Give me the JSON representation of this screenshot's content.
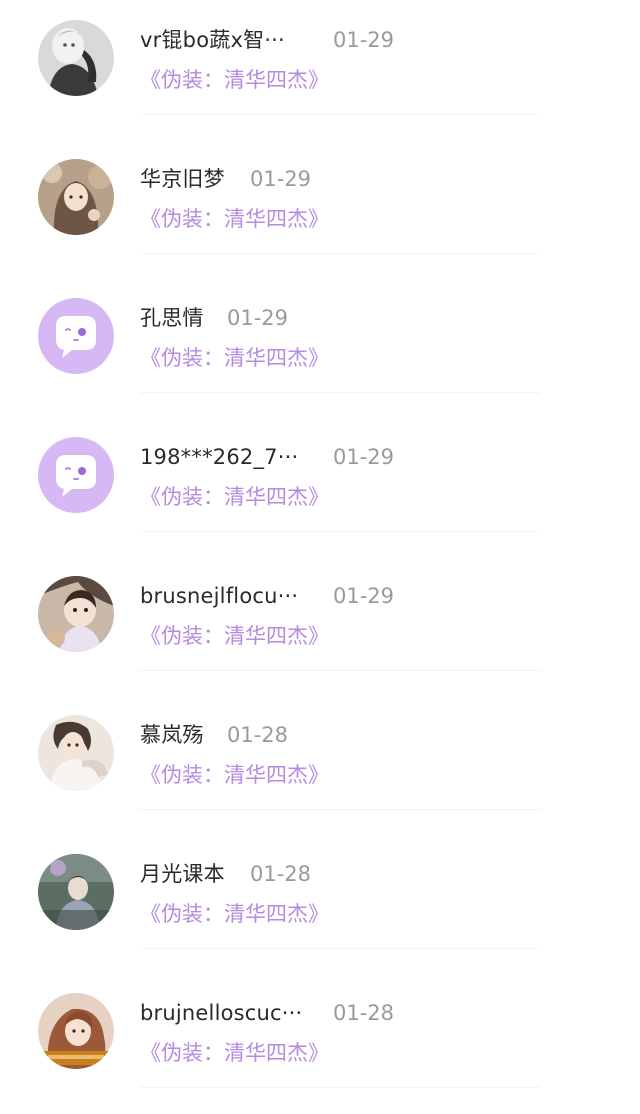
{
  "comments": [
    {
      "name": "vr锟bo蔬x智···",
      "date": "01-29",
      "book": "《伪装：清华四杰》",
      "avatar_icon": "photo-avatar-icon"
    },
    {
      "name": "华京旧梦",
      "date": "01-29",
      "book": "《伪装：清华四杰》",
      "avatar_icon": "photo-avatar-icon"
    },
    {
      "name": "孔思情",
      "date": "01-29",
      "book": "《伪装：清华四杰》",
      "avatar_icon": "default-chat-avatar-icon"
    },
    {
      "name": "198***262_7···",
      "date": "01-29",
      "book": "《伪装：清华四杰》",
      "avatar_icon": "default-chat-avatar-icon"
    },
    {
      "name": "brusnejlflocu···",
      "date": "01-29",
      "book": "《伪装：清华四杰》",
      "avatar_icon": "photo-avatar-icon"
    },
    {
      "name": "慕岚殇",
      "date": "01-28",
      "book": "《伪装：清华四杰》",
      "avatar_icon": "photo-avatar-icon"
    },
    {
      "name": "月光课本",
      "date": "01-28",
      "book": "《伪装：清华四杰》",
      "avatar_icon": "photo-avatar-icon"
    },
    {
      "name": "brujnelloscuc···",
      "date": "01-28",
      "book": "《伪装：清华四杰》",
      "avatar_icon": "photo-avatar-icon"
    }
  ],
  "colors": {
    "accent_purple": "#b48be0",
    "default_avatar_bg": "#d6b8f5",
    "name_text": "#2a2a2a",
    "date_text": "#9a9a9a"
  }
}
